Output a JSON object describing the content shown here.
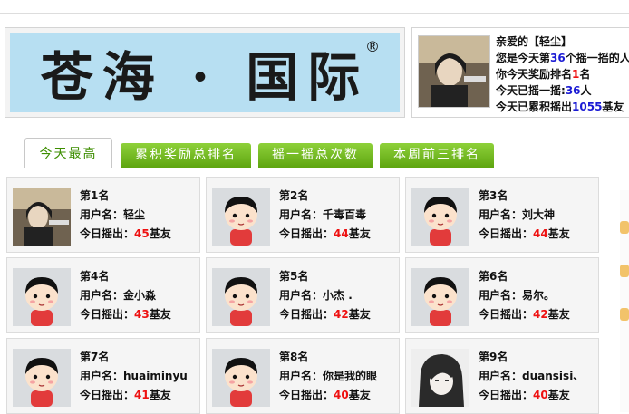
{
  "banner": {
    "text": "苍海 · 国际",
    "reg_mark": "®"
  },
  "user_panel": {
    "line1": "亲爱的【轻尘】",
    "line2_prefix": "您是今天第",
    "line2_num": "36",
    "line2_suffix": "个摇一摇的人",
    "line3_prefix": "你今天奖励排名",
    "line3_num": "1",
    "line3_suffix": "名",
    "line4_prefix": "今天已摇一摇:",
    "line4_num": "36",
    "line4_suffix": "人",
    "line5_prefix": "今天已累积摇出",
    "line5_num": "1055",
    "line5_suffix": "基友"
  },
  "tabs": [
    {
      "label": "今天最高",
      "active": true
    },
    {
      "label": "累积奖励总排名",
      "active": false
    },
    {
      "label": "摇一摇总次数",
      "active": false
    },
    {
      "label": "本周前三排名",
      "active": false
    }
  ],
  "labels": {
    "username": "用户名：",
    "today_prefix": "今日摇出：",
    "today_suffix": "基友"
  },
  "rankings": [
    {
      "rank": "第1名",
      "name": "轻尘",
      "count": "45",
      "avatar": "photo-avatar"
    },
    {
      "rank": "第2名",
      "name": "千毒百毒",
      "count": "44",
      "avatar": "default-avatar"
    },
    {
      "rank": "第3名",
      "name": "刘大神",
      "count": "44",
      "avatar": "default-avatar"
    },
    {
      "rank": "第4名",
      "name": "金小淼",
      "count": "43",
      "avatar": "default-avatar"
    },
    {
      "rank": "第5名",
      "name": "小杰 .",
      "count": "42",
      "avatar": "default-avatar"
    },
    {
      "rank": "第6名",
      "name": "易尔。",
      "count": "42",
      "avatar": "default-avatar"
    },
    {
      "rank": "第7名",
      "name": "huaiminyu",
      "count": "41",
      "avatar": "default-avatar"
    },
    {
      "rank": "第8名",
      "name": "你是我的眼",
      "count": "40",
      "avatar": "default-avatar"
    },
    {
      "rank": "第9名",
      "name": "duansisi、",
      "count": "40",
      "avatar": "anime-avatar"
    }
  ],
  "colors": {
    "tab_green": "#6ab51a",
    "highlight_red": "#e11111",
    "highlight_blue": "#1a1ad4",
    "banner_bg": "#b7dff2"
  }
}
